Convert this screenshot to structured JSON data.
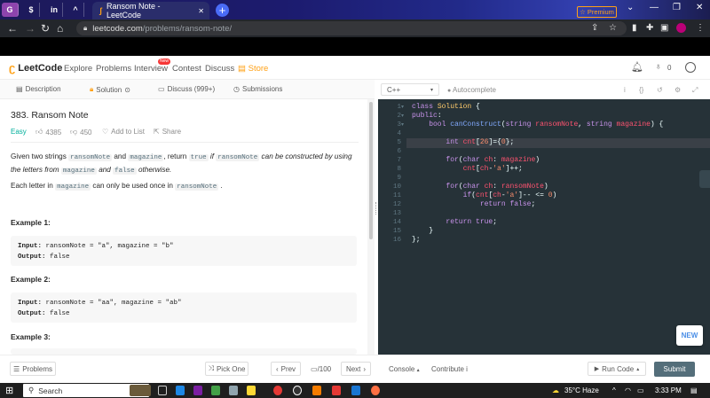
{
  "browser": {
    "pinned_tabs": [
      "G",
      "$",
      "in",
      "^"
    ],
    "active_tab_title": "Ransom Note - LeetCode",
    "close_glyph": "✕",
    "newtab_glyph": "+",
    "url_host": "leetcode.com",
    "url_path": "/problems/ransom-note/",
    "window_controls": [
      "⌄",
      "—",
      "❐",
      "✕"
    ]
  },
  "nav": {
    "logo": "LeetCode",
    "links": [
      "Explore",
      "Problems",
      "Interview",
      "Contest",
      "Discuss",
      "Store"
    ],
    "new_badge": "New",
    "premium": "Premium",
    "notif_count": "0"
  },
  "left_tabs": [
    "Description",
    "Solution",
    "Discuss (999+)",
    "Submissions"
  ],
  "problem": {
    "title": "383. Ransom Note",
    "difficulty": "Easy",
    "likes": "4385",
    "dislikes": "450",
    "add_to_list": "Add to List",
    "share": "Share",
    "desc1_a": "Given two strings",
    "desc1_code1": "ransomNote",
    "desc1_b": "and",
    "desc1_code2": "magazine",
    "desc1_c": ", return",
    "desc1_code3": "true",
    "desc1_d": "if",
    "desc1_code4": "ransomNote",
    "desc1_e": "can be constructed by using the",
    "desc1_f": "letters from",
    "desc1_code5": "magazine",
    "desc1_g": "and",
    "desc1_code6": "false",
    "desc1_h": "otherwise.",
    "desc2_a": "Each letter in",
    "desc2_code1": "magazine",
    "desc2_b": "can only be used once in",
    "desc2_code2": "ransomNote",
    "desc2_c": ".",
    "examples": [
      {
        "head": "Example 1:",
        "input_label": "Input:",
        "input": "ransomNote = \"a\", magazine = \"b\"",
        "output_label": "Output:",
        "output": "false"
      },
      {
        "head": "Example 2:",
        "input_label": "Input:",
        "input": "ransomNote = \"aa\", magazine = \"ab\"",
        "output_label": "Output:",
        "output": "false"
      },
      {
        "head": "Example 3:"
      }
    ]
  },
  "editor": {
    "language": "C++",
    "autocomplete": "Autocomplete",
    "line_numbers": [
      "1",
      "2",
      "3",
      "4",
      "5",
      "6",
      "7",
      "8",
      "9",
      "10",
      "11",
      "12",
      "13",
      "14",
      "15",
      "16"
    ],
    "new_button": "NEW"
  },
  "bottom": {
    "problems": "Problems",
    "pick_one": "Pick One",
    "prev": "Prev",
    "page": "/100",
    "next": "Next",
    "console": "Console",
    "contribute": "Contribute",
    "run_code": "Run Code",
    "submit": "Submit"
  },
  "taskbar": {
    "search": "Search",
    "weather": "35°C  Haze",
    "time": "3:33 PM"
  },
  "colors": {
    "accent": "#ffa116",
    "easy": "#00af9b",
    "editor_bg": "#263238",
    "submit_bg": "#546e7a"
  }
}
